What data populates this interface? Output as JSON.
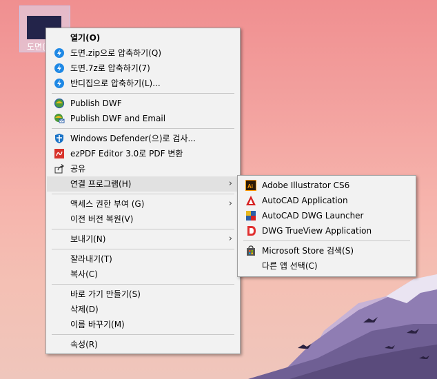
{
  "desktop_icon": {
    "label": "도면("
  },
  "context_menu": {
    "items": [
      {
        "label": "열기(O)",
        "icon": "none"
      },
      {
        "label": "도면.zip으로 압축하기(Q)",
        "icon": "bandizip-icon"
      },
      {
        "label": "도면.7z로 압축하기(7)",
        "icon": "bandizip-icon"
      },
      {
        "label": "반디집으로 압축하기(L)...",
        "icon": "bandizip-icon"
      },
      {
        "label": "Publish DWF",
        "icon": "dwf-icon"
      },
      {
        "label": "Publish DWF and Email",
        "icon": "dwf-email-icon"
      },
      {
        "label": "Windows Defender(으)로 검사...",
        "icon": "defender-shield-icon"
      },
      {
        "label": "ezPDF Editor 3.0로 PDF 변환",
        "icon": "ezpdf-icon"
      },
      {
        "label": "공유",
        "icon": "share-icon"
      },
      {
        "label": "연결 프로그램(H)",
        "icon": "none"
      },
      {
        "label": "액세스 권한 부여 (G)",
        "icon": "none"
      },
      {
        "label": "이전 버전 복원(V)",
        "icon": "none"
      },
      {
        "label": "보내기(N)",
        "icon": "none"
      },
      {
        "label": "잘라내기(T)",
        "icon": "none"
      },
      {
        "label": "복사(C)",
        "icon": "none"
      },
      {
        "label": "바로 가기 만들기(S)",
        "icon": "none"
      },
      {
        "label": "삭제(D)",
        "icon": "none"
      },
      {
        "label": "이름 바꾸기(M)",
        "icon": "none"
      },
      {
        "label": "속성(R)",
        "icon": "none"
      }
    ]
  },
  "open_with_submenu": {
    "items": [
      {
        "label": "Adobe Illustrator CS6",
        "icon": "illustrator-icon"
      },
      {
        "label": "AutoCAD Application",
        "icon": "autocad-icon"
      },
      {
        "label": "AutoCAD DWG Launcher",
        "icon": "dwg-launcher-icon"
      },
      {
        "label": "DWG TrueView Application",
        "icon": "dwg-trueview-icon"
      },
      {
        "label": "Microsoft Store 검색(S)",
        "icon": "store-icon"
      },
      {
        "label": "다른 앱 선택(C)",
        "icon": "none"
      }
    ]
  },
  "colors": {
    "menu_background": "#f2f2f2",
    "highlight": "#e1e1e1",
    "bandizip_blue": "#1e88e5",
    "autocad_red": "#d62020",
    "illustrator_orange": "#ff9a00"
  }
}
